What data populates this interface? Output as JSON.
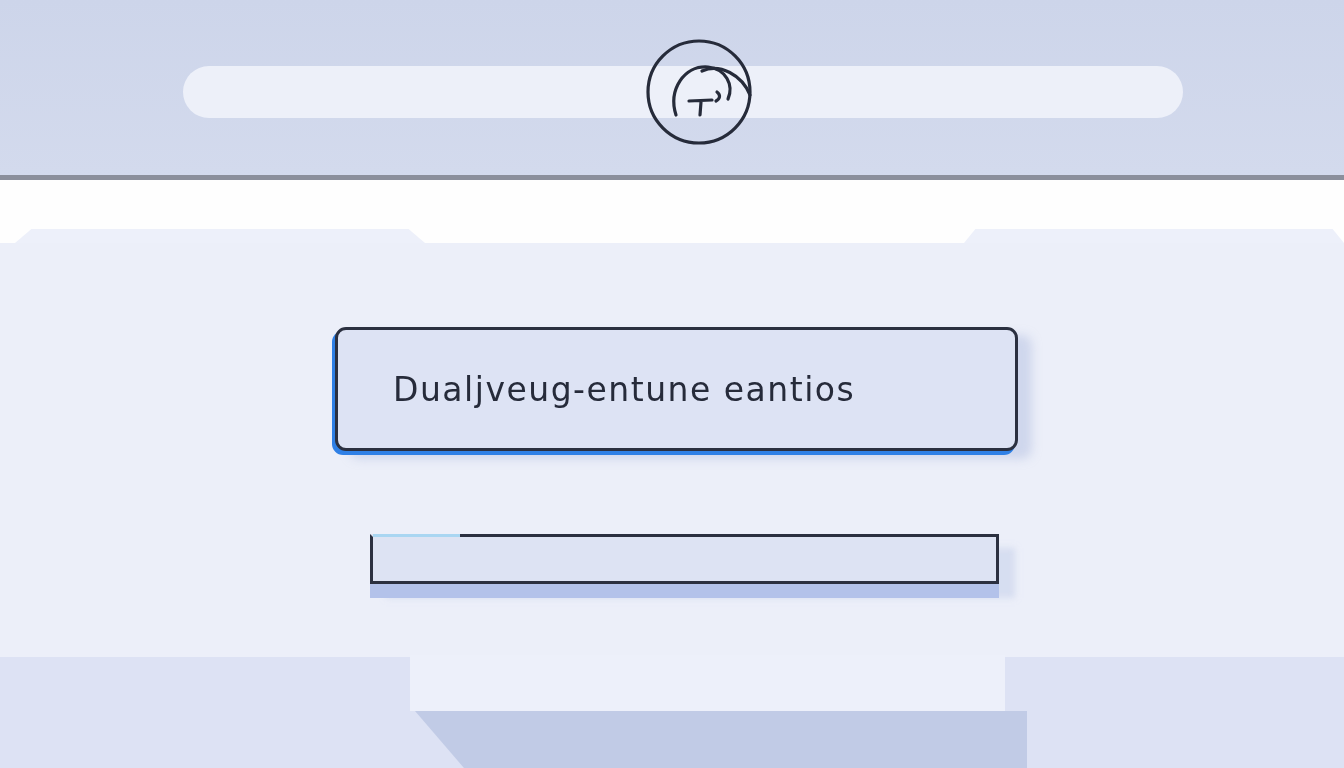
{
  "main_field": {
    "value": "Dualjveug-entune eantios"
  }
}
